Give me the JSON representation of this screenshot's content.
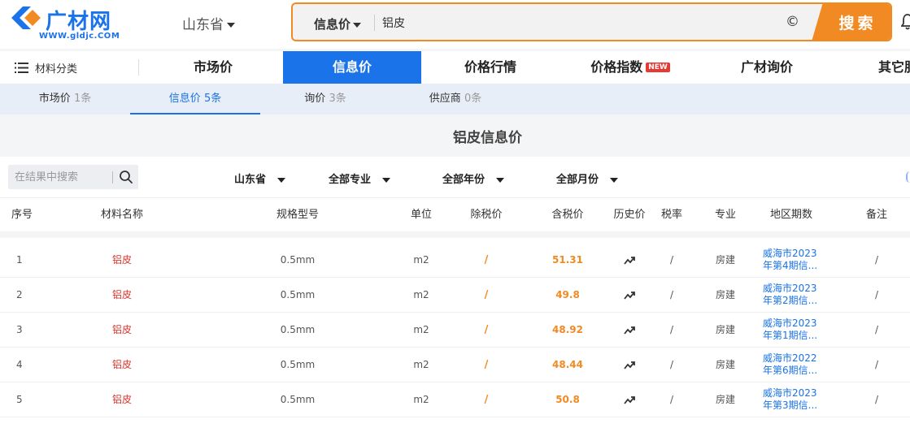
{
  "header": {
    "logo_name": "广材网",
    "logo_url": "WWW.gldjc.COM",
    "province": "山东省",
    "search": {
      "type": "信息价",
      "value": "铝皮",
      "button": "搜索"
    }
  },
  "mainnav": {
    "category": "材料分类",
    "items": [
      {
        "label": "市场价"
      },
      {
        "label": "信息价"
      },
      {
        "label": "价格行情"
      },
      {
        "label": "价格指数",
        "badge": "NEW"
      },
      {
        "label": "广材询价"
      },
      {
        "label": "其它服"
      }
    ]
  },
  "subtabs": [
    {
      "label": "市场价",
      "count": "1条"
    },
    {
      "label": "信息价",
      "count": "5条"
    },
    {
      "label": "询价",
      "count": "3条"
    },
    {
      "label": "供应商",
      "count": "0条"
    }
  ],
  "section_title": "铝皮信息价",
  "filters": {
    "search_placeholder": "在结果中搜索",
    "province": "山东省",
    "specialty": "全部专业",
    "year": "全部年份",
    "month": "全部月份"
  },
  "table": {
    "headers": [
      "序号",
      "材料名称",
      "规格型号",
      "单位",
      "除税价",
      "含税价",
      "历史价",
      "税率",
      "专业",
      "地区期数",
      "备注"
    ],
    "rows": [
      {
        "no": "1",
        "name": "铝皮",
        "spec": "0.5mm",
        "unit": "m2",
        "pretax": "/",
        "price": "51.31",
        "tax": "/",
        "specialty": "房建",
        "region": "威海市2023年第4期信...",
        "note": "/"
      },
      {
        "no": "2",
        "name": "铝皮",
        "spec": "0.5mm",
        "unit": "m2",
        "pretax": "/",
        "price": "49.8",
        "tax": "/",
        "specialty": "房建",
        "region": "威海市2023年第2期信...",
        "note": "/"
      },
      {
        "no": "3",
        "name": "铝皮",
        "spec": "0.5mm",
        "unit": "m2",
        "pretax": "/",
        "price": "48.92",
        "tax": "/",
        "specialty": "房建",
        "region": "威海市2023年第1期信...",
        "note": "/"
      },
      {
        "no": "4",
        "name": "铝皮",
        "spec": "0.5mm",
        "unit": "m2",
        "pretax": "/",
        "price": "48.44",
        "tax": "/",
        "specialty": "房建",
        "region": "威海市2022年第6期信...",
        "note": "/"
      },
      {
        "no": "5",
        "name": "铝皮",
        "spec": "0.5mm",
        "unit": "m2",
        "pretax": "/",
        "price": "50.8",
        "tax": "/",
        "specialty": "房建",
        "region": "威海市2023年第3期信...",
        "note": "/"
      }
    ]
  },
  "colors": {
    "brand_blue": "#1a73e8",
    "accent_orange": "#f28a23",
    "name_red": "#d9342b",
    "badge_red": "#e53935"
  },
  "icons": [
    "logo-mark-icon",
    "caret-down-icon",
    "clear-icon",
    "bell-icon",
    "menu-icon",
    "search-icon",
    "trend-icon"
  ]
}
